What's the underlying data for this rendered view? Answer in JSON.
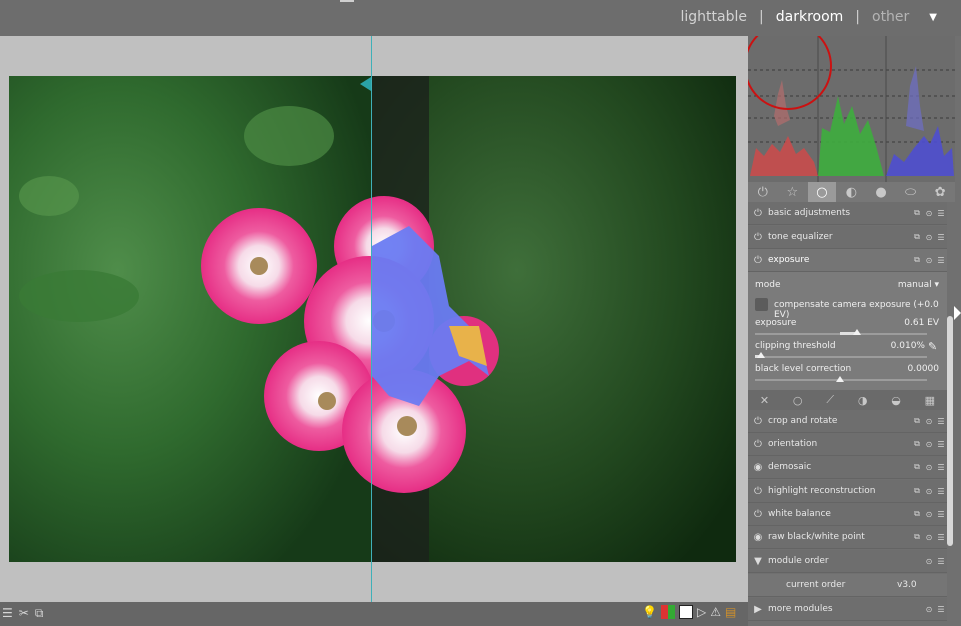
{
  "views": {
    "lighttable": "lighttable",
    "darkroom": "darkroom",
    "other": "other",
    "sep": "|"
  },
  "split_marker": "S",
  "modules_top": [
    {
      "label": "basic adjustments",
      "icon": "power-icon"
    },
    {
      "label": "tone equalizer",
      "icon": "power-icon"
    },
    {
      "label": "exposure",
      "icon": "power-icon"
    }
  ],
  "exposure": {
    "mode_label": "mode",
    "mode_value": "manual",
    "compensate_label": "compensate camera exposure (+0.0 EV)",
    "exposure_label": "exposure",
    "exposure_value": "0.61 EV",
    "clipping_label": "clipping threshold",
    "clipping_value": "0.010%",
    "black_label": "black level correction",
    "black_value": "0.0000"
  },
  "modules_bottom": [
    {
      "label": "crop and rotate"
    },
    {
      "label": "orientation"
    },
    {
      "label": "demosaic"
    },
    {
      "label": "highlight reconstruction"
    },
    {
      "label": "white balance"
    },
    {
      "label": "raw black/white point"
    },
    {
      "label": "module order"
    }
  ],
  "module_order": {
    "label": "current order",
    "value": "v3.0"
  },
  "more_modules": "more modules",
  "colors": {
    "accent": "#3fb0b8",
    "circle": "#cc1111"
  }
}
